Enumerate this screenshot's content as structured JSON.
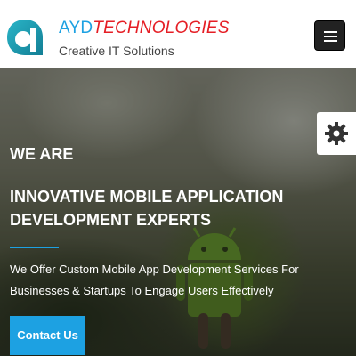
{
  "header": {
    "brand_ayd": "AYD",
    "brand_tech": "TECHNOLOGIES",
    "tagline": "Creative IT Solutions",
    "menu_icon": "hamburger-menu-icon"
  },
  "hero": {
    "eyebrow": "WE ARE",
    "headline_line1": "INNOVATIVE MOBILE APPLICATION",
    "headline_line2": "DEVELOPMENT EXPERTS",
    "description_line1": "We Offer Custom Mobile App Development Services For",
    "description_line2": "Businesses & Startups To Engage Users Effectively",
    "cta_label": "Contact Us",
    "background_icon": "android-robot-icon"
  },
  "settings_tab": {
    "icon": "gear-icon"
  },
  "colors": {
    "accent_blue": "#1da1e2",
    "brand_red": "#e51e25",
    "menu_button": "#222222"
  }
}
